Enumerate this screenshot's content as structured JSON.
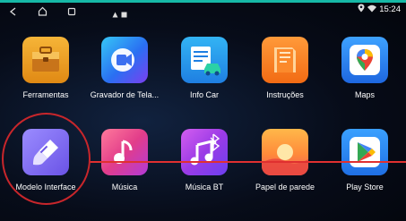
{
  "status_bar": {
    "nav_icons": [
      "back-icon",
      "home-icon",
      "recents-icon"
    ],
    "notification_icons": [
      "warning-icon",
      "image-icon"
    ],
    "system_icons": [
      "location-icon",
      "wifi-icon"
    ],
    "time": "15:24"
  },
  "apps_row1": [
    {
      "label": "Ferramentas",
      "icon": "toolbox-icon"
    },
    {
      "label": "Gravador de Tela...",
      "icon": "screen-recorder-icon"
    },
    {
      "label": "Info Car",
      "icon": "info-car-icon"
    },
    {
      "label": "Instruções",
      "icon": "instructions-icon"
    },
    {
      "label": "Maps",
      "icon": "maps-icon"
    }
  ],
  "apps_row2": [
    {
      "label": "Modelo Interface",
      "icon": "theme-brush-icon"
    },
    {
      "label": "Música",
      "icon": "music-icon"
    },
    {
      "label": "Música BT",
      "icon": "bluetooth-music-icon"
    },
    {
      "label": "Papel de parede",
      "icon": "wallpaper-icon"
    },
    {
      "label": "Play Store",
      "icon": "play-store-icon"
    }
  ],
  "colors": {
    "annotation_red": "#c8262b",
    "accent_teal": "#16b8a6"
  }
}
